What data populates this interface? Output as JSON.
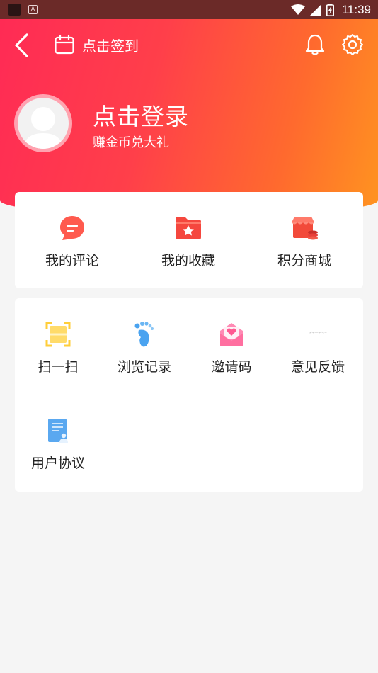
{
  "status_bar": {
    "time": "11:39"
  },
  "header": {
    "signin_label": "点击签到"
  },
  "profile": {
    "login_title": "点击登录",
    "login_subtitle": "赚金币兑大礼"
  },
  "quick_actions": [
    {
      "label": "我的评论",
      "icon": "comment-icon",
      "color": "#ff5a4e"
    },
    {
      "label": "我的收藏",
      "icon": "favorites-folder-icon",
      "color": "#f5473e"
    },
    {
      "label": "积分商城",
      "icon": "points-shop-icon",
      "color": "#f24a3a"
    }
  ],
  "services": [
    {
      "label": "扫一扫",
      "icon": "scan-icon",
      "color": "#ffd24a"
    },
    {
      "label": "浏览记录",
      "icon": "footprint-icon",
      "color": "#4aa3f0"
    },
    {
      "label": "邀请码",
      "icon": "invite-envelope-icon",
      "color": "#ff6fa0"
    },
    {
      "label": "意见反馈",
      "icon": "feedback-icon",
      "color": "#cccccc"
    },
    {
      "label": "用户协议",
      "icon": "user-agreement-icon",
      "color": "#5aa8f0"
    }
  ],
  "colors": {
    "header_gradient_start": "#ff2a55",
    "header_gradient_end": "#ff9420",
    "background": "#f5f5f5"
  }
}
